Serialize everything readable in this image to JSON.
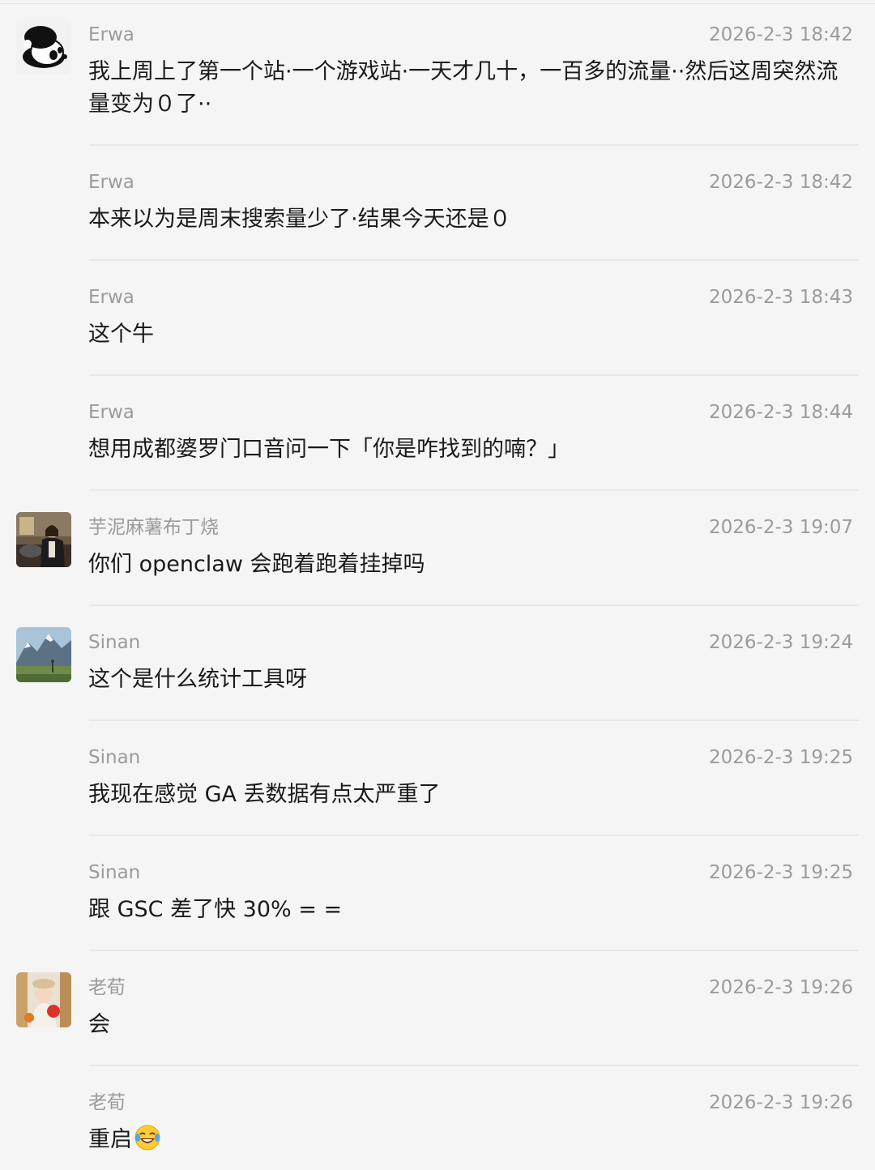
{
  "messages": [
    {
      "sender": "Erwa",
      "time": "2026-2-3 18:42",
      "text": "我上周上了第一个站·一个游戏站·一天才几十，一百多的流量··然后这周突然流量变为０了··",
      "avatar": "panda-avatar"
    },
    {
      "sender": "Erwa",
      "time": "2026-2-3 18:42",
      "text": "本来以为是周末搜索量少了·结果今天还是０",
      "avatar": ""
    },
    {
      "sender": "Erwa",
      "time": "2026-2-3 18:43",
      "text": "这个牛",
      "avatar": ""
    },
    {
      "sender": "Erwa",
      "time": "2026-2-3 18:44",
      "text": "想用成都婆罗门口音问一下「你是咋找到的喃？」",
      "avatar": ""
    },
    {
      "sender": "芋泥麻薯布丁烧",
      "time": "2026-2-3 19:07",
      "text": "你们 openclaw 会跑着跑着挂掉吗",
      "avatar": "person-photo-avatar"
    },
    {
      "sender": "Sinan",
      "time": "2026-2-3 19:24",
      "text": "这个是什么统计工具呀",
      "avatar": "mountain-photo-avatar"
    },
    {
      "sender": "Sinan",
      "time": "2026-2-3 19:25",
      "text": "我现在感觉 GA 丢数据有点太严重了",
      "avatar": ""
    },
    {
      "sender": "Sinan",
      "time": "2026-2-3 19:25",
      "text": "跟 GSC 差了快 30% = =",
      "avatar": ""
    },
    {
      "sender": "老荀",
      "time": "2026-2-3 19:26",
      "text": "会",
      "avatar": "girl-photo-avatar"
    },
    {
      "sender": "老荀",
      "time": "2026-2-3 19:26",
      "text": "重启",
      "avatar": "",
      "emoji": "laughing-tears-emoji"
    }
  ]
}
